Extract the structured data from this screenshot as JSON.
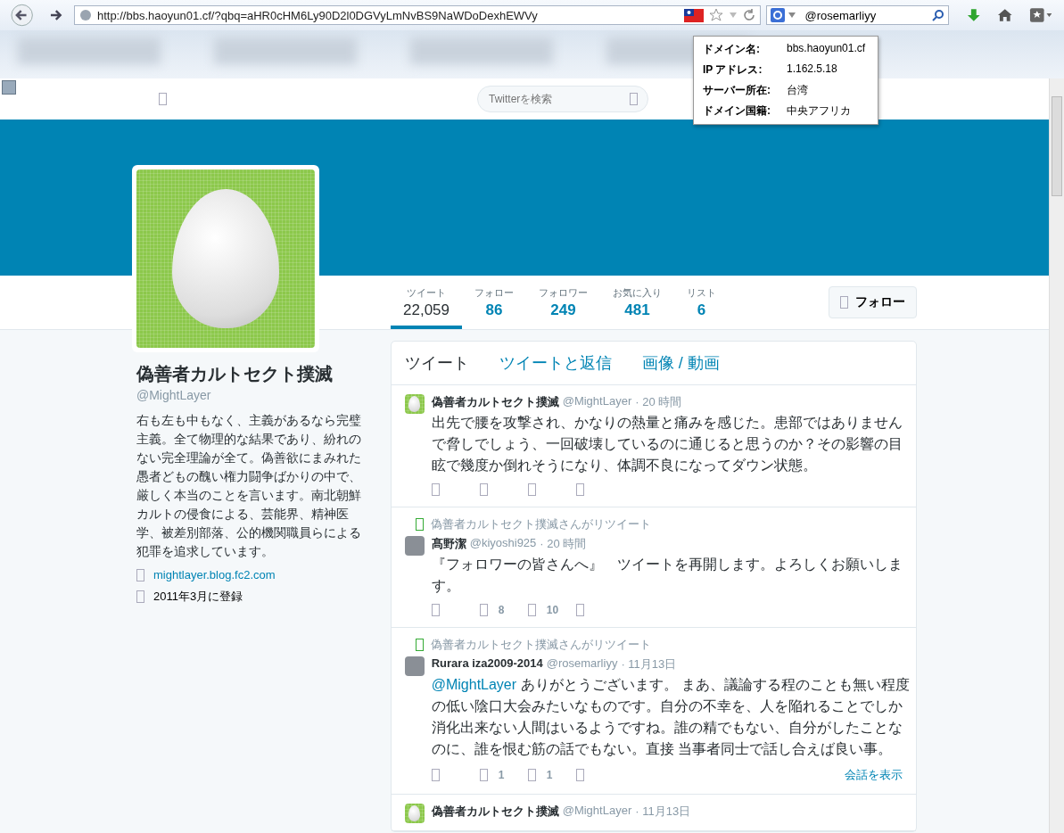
{
  "browser": {
    "url": "http://bbs.haoyun01.cf/?qbq=aHR0cHM6Ly90D2l0DGVyLmNvBS9NaWDoDexhEWVy",
    "search_value": "@rosemarliyy"
  },
  "site_info": [
    {
      "label": "ドメイン名:",
      "value": "bbs.haoyun01.cf"
    },
    {
      "label": "IP アドレス:",
      "value": "1.162.5.18"
    },
    {
      "label": "サーバー所在:",
      "value": "台湾"
    },
    {
      "label": "ドメイン国籍:",
      "value": "中央アフリカ"
    }
  ],
  "topbar": {
    "search": {
      "placeholder": "Twitterを検索"
    }
  },
  "stats": [
    {
      "label": "ツイート",
      "value": "22,059",
      "selected": true
    },
    {
      "label": "フォロー",
      "value": "86",
      "selected": false
    },
    {
      "label": "フォロワー",
      "value": "249",
      "selected": false
    },
    {
      "label": "お気に入り",
      "value": "481",
      "selected": false
    },
    {
      "label": "リスト",
      "value": "6",
      "selected": false
    }
  ],
  "follow_button": "フォロー",
  "profile": {
    "name": "偽善者カルトセクト撲滅",
    "handle": "@MightLayer",
    "bio": "右も左も中もなく、主義があるなら完璧主義。全て物理的な結果であり、紛れのない完全理論が全て。偽善欲にまみれた愚者どもの醜い権力闘争ばかりの中で、厳しく本当のことを言います。南北朝鮮カルトの侵食による、芸能界、精神医学、被差別部落、公的機関職員らによる犯罪を追求しています。",
    "website": "mightlayer.blog.fc2.com",
    "joined": "2011年3月に登録"
  },
  "timeline_tabs": [
    {
      "label": "ツイート",
      "selected": true
    },
    {
      "label": "ツイートと返信",
      "selected": false
    },
    {
      "label": "画像 / 動画",
      "selected": false
    }
  ],
  "tweets": [
    {
      "name": "偽善者カルトセクト撲滅",
      "handle": "@MightLayer",
      "time": "· 20 時間",
      "text": "出先で腰を攻撃され、かなりの熱量と痛みを感じた。患部ではありませんで脅しでしょう、一回破壊しているのに通じると思うのか？その影響の目眩で幾度か倒れそうになり、体調不良になってダウン状態。"
    },
    {
      "retweeted_by": "偽善者カルトセクト撲滅さんがリツイート",
      "name": "髙野潔",
      "handle": "@kiyoshi925",
      "time": "· 20 時間",
      "text": "『フォロワーの皆さんへ』　ツイートを再開します。よろしくお願いします。",
      "retweets": "8",
      "favorites": "10"
    },
    {
      "retweeted_by": "偽善者カルトセクト撲滅さんがリツイート",
      "name": "Rurara iza2009-2014",
      "handle": "@rosemarliyy",
      "time": "· 11月13日",
      "mention": "@MightLayer",
      "text": "ありがとうございます。 まあ、議論する程のことも無い程度の低い陰口大会みたいなものです。自分の不幸を、人を陥れることでしか消化出来ない人間はいるようですね。誰の精でもない、自分がしたことなのに、誰を恨む筋の話でもない。直接 当事者同士で話し合えば良い事。",
      "retweets": "1",
      "favorites": "1",
      "conversation": "会話を表示"
    },
    {
      "name": "偽善者カルトセクト撲滅",
      "handle": "@MightLayer",
      "time": "· 11月13日"
    }
  ]
}
